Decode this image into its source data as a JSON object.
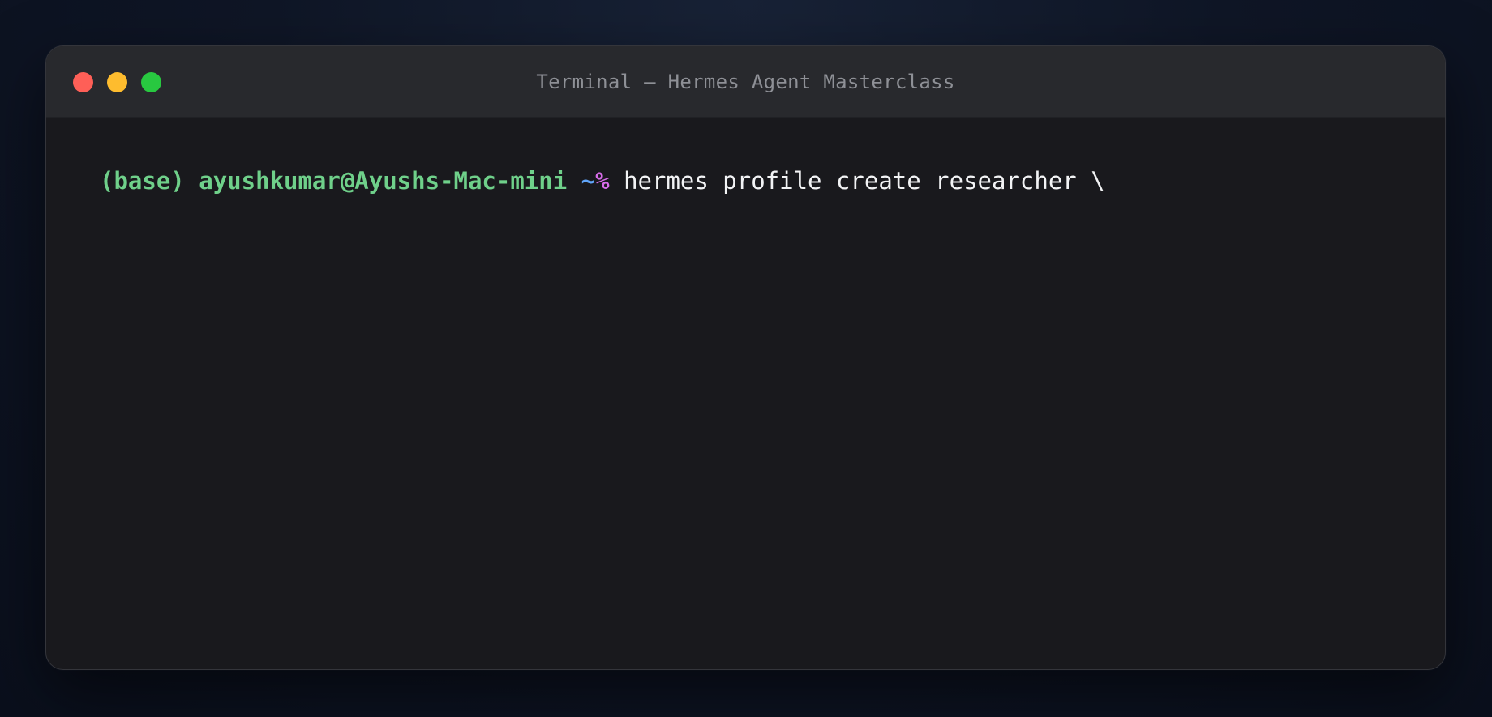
{
  "window": {
    "title": "Terminal — Hermes Agent Masterclass"
  },
  "terminal": {
    "env": "(base)",
    "user_host": "ayushkumar@Ayushs-Mac-mini",
    "cwd": "~",
    "prompt_symbol": "%",
    "command": "hermes profile create researcher \\"
  },
  "colors": {
    "close": "#fe5f57",
    "minimize": "#febc2e",
    "zoom": "#28c840",
    "prompt_green": "#6fd08a",
    "tilde_blue": "#60a5fa",
    "percent_magenta": "#d66ce8"
  }
}
